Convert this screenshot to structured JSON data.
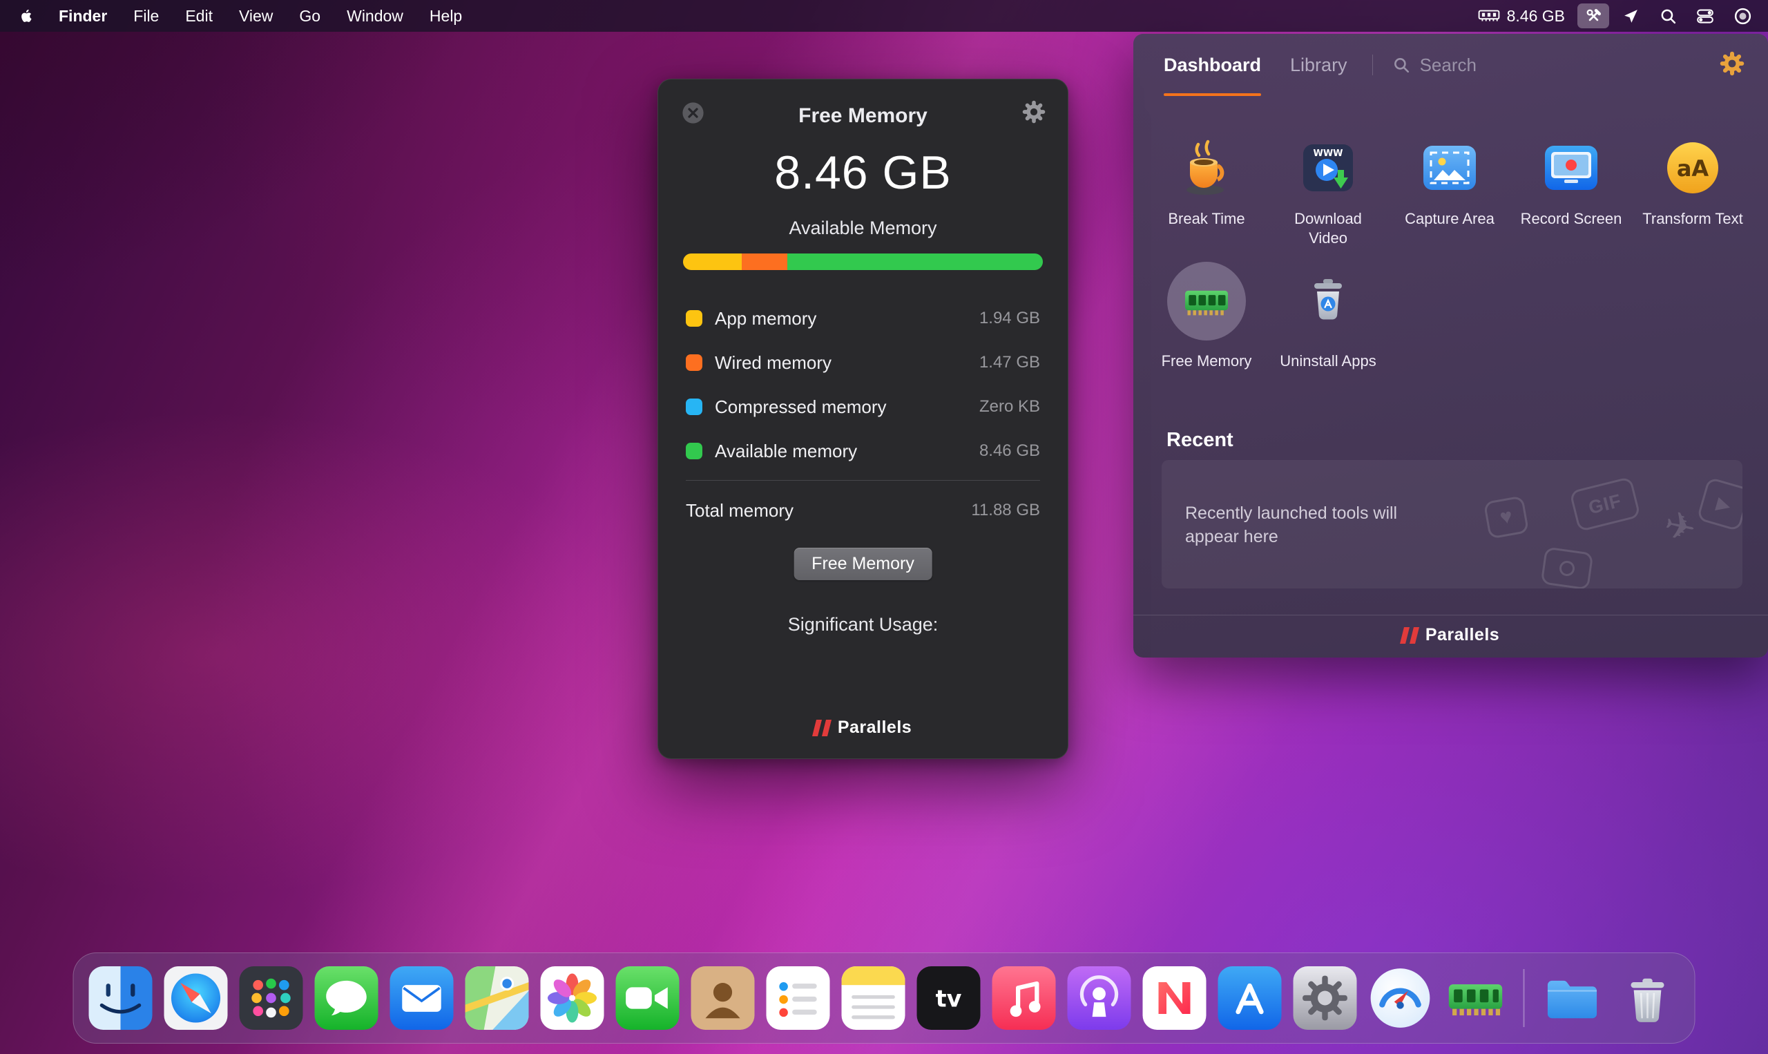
{
  "menu_bar": {
    "app_menu": "Finder",
    "menus": [
      "File",
      "Edit",
      "View",
      "Go",
      "Window",
      "Help"
    ],
    "memory_status": "8.46 GB"
  },
  "free_memory_window": {
    "title": "Free Memory",
    "available_value": "8.46 GB",
    "available_label": "Available Memory",
    "legend": [
      {
        "label": "App memory",
        "value": "1.94 GB",
        "color": "#fdc411",
        "pct": 16.4
      },
      {
        "label": "Wired memory",
        "value": "1.47 GB",
        "color": "#fd6f20",
        "pct": 12.5
      },
      {
        "label": "Compressed memory",
        "value": "Zero KB",
        "color": "#27b5f4",
        "pct": 0
      },
      {
        "label": "Available memory",
        "value": "8.46 GB",
        "color": "#32c94e",
        "pct": 71.1
      }
    ],
    "total_label": "Total memory",
    "total_value": "11.88 GB",
    "free_button": "Free Memory",
    "significant_usage": "Significant Usage:",
    "brand": "Parallels"
  },
  "toolbox_panel": {
    "tab_dashboard": "Dashboard",
    "tab_library": "Library",
    "search_placeholder": "Search",
    "tools": [
      {
        "label": "Break Time"
      },
      {
        "label": "Download Video",
        "badge": "WWW"
      },
      {
        "label": "Capture Area"
      },
      {
        "label": "Record Screen"
      },
      {
        "label": "Transform Text",
        "glyph": "aA"
      },
      {
        "label": "Free Memory"
      },
      {
        "label": "Uninstall Apps"
      }
    ],
    "recent_title": "Recent",
    "recent_empty": "Recently launched tools will appear here",
    "gif_badge": "GIF",
    "ghosts": {
      "heart": "♥",
      "plane": "✈",
      "play": "▶"
    },
    "brand": "Parallels"
  },
  "dock": {
    "apps": [
      "Finder",
      "Safari",
      "Launchpad",
      "Messages",
      "Mail",
      "Maps",
      "Photos",
      "FaceTime",
      "Contacts",
      "Reminders",
      "Notes",
      "TV",
      "Music",
      "Podcasts",
      "News",
      "App Store",
      "System Preferences",
      "Parallels Toolbox",
      "Free Memory",
      "Downloads",
      "Trash"
    ],
    "tv_glyph": "tv"
  },
  "colors": {
    "accent_orange": "#f4731c",
    "parallels_red": "#e23b3b"
  }
}
